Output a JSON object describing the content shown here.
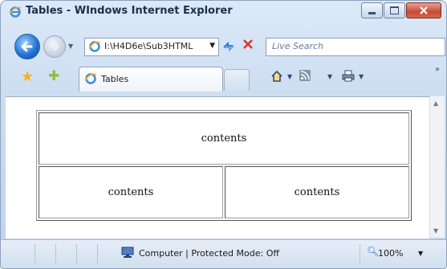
{
  "window": {
    "title": "Tables - WIndows Internet Explorer"
  },
  "address": {
    "url": "I:\\H4D6e\\Sub3HTML",
    "dropdown_glyph": "▼"
  },
  "search": {
    "placeholder": "Live Search"
  },
  "tabs": [
    {
      "label": "Tables",
      "active": true
    }
  ],
  "toolbar": {
    "chevrons": "»",
    "drop": "▼"
  },
  "content": {
    "table": {
      "rows": [
        [
          {
            "text": "contents",
            "colspan": 2
          }
        ],
        [
          {
            "text": "contents"
          },
          {
            "text": "contents"
          }
        ]
      ]
    }
  },
  "status": {
    "zone": "Computer | Protected Mode: Off",
    "zoom": "100%",
    "zoom_drop": "▼"
  },
  "icons": {
    "back": "back-arrow-icon",
    "forward": "forward-arrow-icon",
    "refresh": "refresh-icon",
    "stop": "stop-icon",
    "favorites": "star-icon",
    "add_favorites": "add-favorites-icon",
    "home": "home-icon",
    "feeds": "feeds-icon",
    "print": "print-icon",
    "zoom": "zoom-icon"
  },
  "colors": {
    "chrome": "#cbdcf0",
    "close_button": "#c74a35",
    "stop": "#dd3333",
    "favorites": "#f3b21b"
  }
}
